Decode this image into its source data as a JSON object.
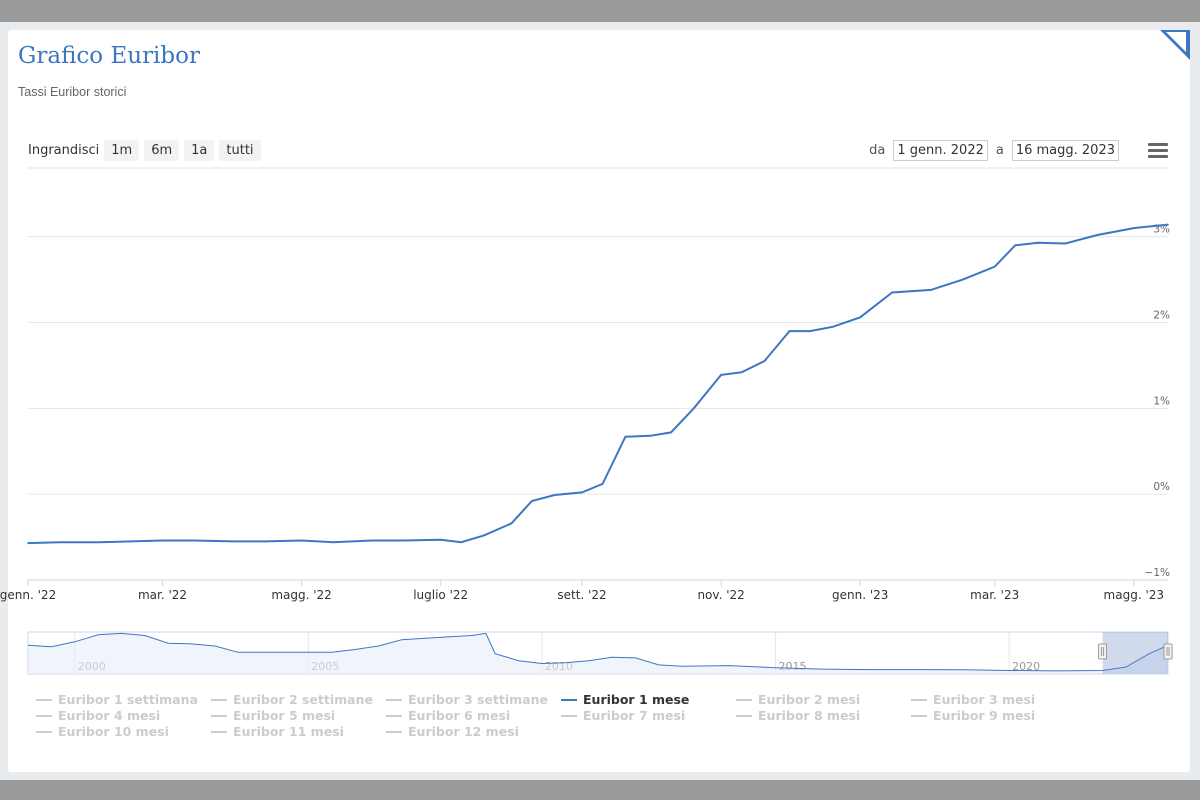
{
  "title": "Grafico Euribor",
  "subtitle": "Tassi Euribor storici",
  "zoom": {
    "label": "Ingrandisci",
    "buttons": [
      "1m",
      "6m",
      "1a",
      "tutti"
    ]
  },
  "range": {
    "from_label": "da",
    "from_value": "1 genn. 2022",
    "to_label": "a",
    "to_value": "16 magg. 2023"
  },
  "colors": {
    "accent": "#3d76c1",
    "inactive": "#cccccc"
  },
  "chart_data": {
    "type": "line",
    "series": [
      {
        "name": "Euribor 1 mese",
        "x": [
          "2022-01-01",
          "2022-01-15",
          "2022-02-01",
          "2022-02-15",
          "2022-03-01",
          "2022-03-15",
          "2022-04-01",
          "2022-04-15",
          "2022-05-01",
          "2022-05-15",
          "2022-06-01",
          "2022-06-15",
          "2022-07-01",
          "2022-07-10",
          "2022-07-20",
          "2022-08-01",
          "2022-08-10",
          "2022-08-20",
          "2022-09-01",
          "2022-09-10",
          "2022-09-20",
          "2022-10-01",
          "2022-10-10",
          "2022-10-20",
          "2022-11-01",
          "2022-11-10",
          "2022-11-20",
          "2022-12-01",
          "2022-12-10",
          "2022-12-20",
          "2023-01-01",
          "2023-01-15",
          "2023-02-01",
          "2023-02-15",
          "2023-03-01",
          "2023-03-10",
          "2023-03-20",
          "2023-04-01",
          "2023-04-15",
          "2023-05-01",
          "2023-05-16"
        ],
        "y": [
          -0.57,
          -0.56,
          -0.56,
          -0.55,
          -0.54,
          -0.54,
          -0.55,
          -0.55,
          -0.54,
          -0.56,
          -0.54,
          -0.54,
          -0.53,
          -0.56,
          -0.48,
          -0.34,
          -0.08,
          -0.01,
          0.02,
          0.12,
          0.67,
          0.68,
          0.72,
          1.0,
          1.39,
          1.42,
          1.55,
          1.9,
          1.9,
          1.95,
          2.06,
          2.35,
          2.38,
          2.5,
          2.65,
          2.9,
          2.93,
          2.92,
          3.02,
          3.1,
          3.14
        ]
      }
    ],
    "y_ticks": [
      "−1%",
      "0%",
      "1%",
      "2%",
      "3%"
    ],
    "ylim": [
      -1,
      3.8
    ],
    "x_ticks": [
      "genn. '22",
      "mar. '22",
      "magg. '22",
      "luglio '22",
      "sett. '22",
      "nov. '22",
      "genn. '23",
      "mar. '23",
      "magg. '23"
    ],
    "grid": true,
    "navigator": {
      "years": [
        "2000",
        "2005",
        "2010",
        "2015",
        "2020"
      ],
      "x": [
        1999.0,
        1999.5,
        2000.0,
        2000.5,
        2001.0,
        2001.5,
        2002.0,
        2002.5,
        2003.0,
        2003.5,
        2004.0,
        2004.5,
        2005.0,
        2005.5,
        2006.0,
        2006.5,
        2007.0,
        2007.5,
        2008.0,
        2008.5,
        2008.8,
        2009.0,
        2009.5,
        2010.0,
        2010.5,
        2011.0,
        2011.5,
        2012.0,
        2012.5,
        2013.0,
        2014.0,
        2015.0,
        2016.0,
        2017.0,
        2018.0,
        2019.0,
        2020.0,
        2021.0,
        2022.0,
        2022.5,
        2023.0,
        2023.4
      ],
      "y": [
        3.1,
        2.9,
        3.6,
        4.6,
        4.8,
        4.5,
        3.4,
        3.3,
        3.0,
        2.1,
        2.1,
        2.1,
        2.1,
        2.1,
        2.5,
        3.0,
        3.9,
        4.1,
        4.3,
        4.5,
        4.8,
        1.9,
        0.9,
        0.5,
        0.6,
        0.9,
        1.4,
        1.3,
        0.3,
        0.1,
        0.2,
        -0.1,
        -0.3,
        -0.37,
        -0.37,
        -0.4,
        -0.5,
        -0.55,
        -0.5,
        0.0,
        1.9,
        3.1
      ],
      "selection": [
        "2022-01-01",
        "2023-05-16"
      ]
    }
  },
  "legend": [
    {
      "label": "Euribor 1 settimana",
      "active": false
    },
    {
      "label": "Euribor 2 settimane",
      "active": false
    },
    {
      "label": "Euribor 3 settimane",
      "active": false
    },
    {
      "label": "Euribor 1 mese",
      "active": true
    },
    {
      "label": "Euribor 2 mesi",
      "active": false
    },
    {
      "label": "Euribor 3 mesi",
      "active": false
    },
    {
      "label": "Euribor 4 mesi",
      "active": false
    },
    {
      "label": "Euribor 5 mesi",
      "active": false
    },
    {
      "label": "Euribor 6 mesi",
      "active": false
    },
    {
      "label": "Euribor 7 mesi",
      "active": false
    },
    {
      "label": "Euribor 8 mesi",
      "active": false
    },
    {
      "label": "Euribor 9 mesi",
      "active": false
    },
    {
      "label": "Euribor 10 mesi",
      "active": false
    },
    {
      "label": "Euribor 11 mesi",
      "active": false
    },
    {
      "label": "Euribor 12 mesi",
      "active": false
    }
  ]
}
